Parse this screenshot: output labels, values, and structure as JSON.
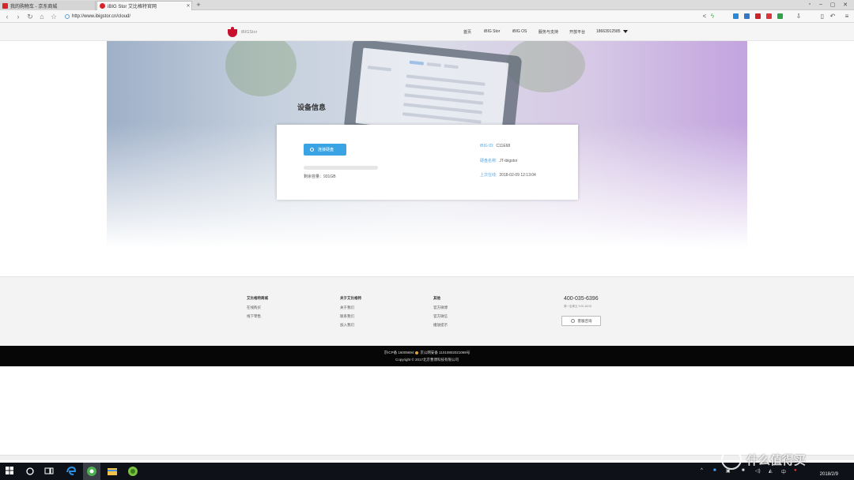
{
  "browser": {
    "tabs": [
      {
        "label": "我的购物车 - 京东商城",
        "favicon": "jd-icon",
        "active": false
      },
      {
        "label": "iBIG Stor 艾比格特官网",
        "favicon": "ibig-icon",
        "active": true
      }
    ],
    "new_tab_glyph": "+",
    "address": "http://www.ibigstor.cn/cloud/",
    "nav_icons": [
      "back-icon",
      "forward-icon",
      "refresh-icon",
      "home-icon",
      "star-icon"
    ],
    "toolbar_icons": [
      "share-icon",
      "lightning-icon",
      "extension-icon",
      "downloads-icon",
      "undo-icon",
      "menu-icon"
    ]
  },
  "site": {
    "logo_text": "iBIGStor",
    "nav": [
      {
        "label": "首页"
      },
      {
        "label": "iBIG Stor"
      },
      {
        "label": "iBIG OS"
      },
      {
        "label": "服务与支持"
      },
      {
        "label": "开放平台"
      }
    ],
    "account_phone": "18663912585"
  },
  "page": {
    "title": "设备信息"
  },
  "device": {
    "connect_button": "连接硬盘",
    "progress_fraction": 0.0,
    "capacity": "剩余容量：931GB",
    "info": [
      {
        "key": "iBIG ID:",
        "value": "C11E68"
      },
      {
        "key": "硬盘名称:",
        "value": "JT-ibigstor"
      },
      {
        "key": "上次在线:",
        "value": "2018-02-09 12:13:04"
      }
    ]
  },
  "footer": {
    "columns": [
      {
        "heading": "艾比格特商城",
        "items": [
          "在线购买",
          "线下零售"
        ]
      },
      {
        "heading": "关于艾比格特",
        "items": [
          "关于我们",
          "联系我们",
          "加入我们"
        ]
      },
      {
        "heading": "其他",
        "items": [
          "官方微博",
          "官方微信",
          "播放提示"
        ]
      }
    ],
    "hotline": "400-035-6396",
    "hours": "周一至周五 9:00-18:00",
    "service_button": "客服咨询",
    "icp_prefix": "京ICP备 16005694",
    "icp_suffix": "京公网安备 11010802021098号",
    "copyright": "Copyright © 2017北京曹博科技有限公司"
  },
  "taskbar": {
    "icons": [
      "windows-start-icon",
      "cortana-icon",
      "task-view-icon",
      "edge-icon",
      "browser-icon",
      "file-explorer-icon",
      "green-app-icon"
    ],
    "date": "2018/2/9"
  },
  "watermark": "什么值得买"
}
